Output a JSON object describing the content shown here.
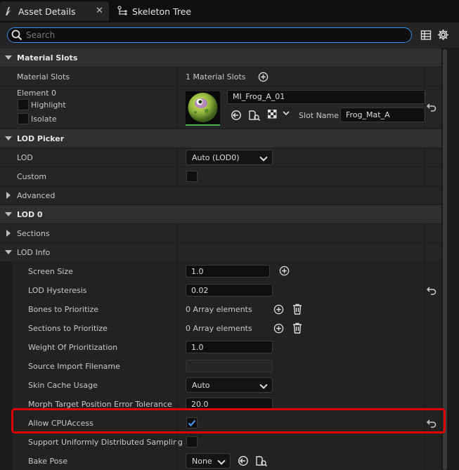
{
  "tabs": [
    {
      "label": "Asset Details",
      "active": true
    },
    {
      "label": "Skeleton Tree",
      "active": false
    }
  ],
  "search": {
    "placeholder": "Search",
    "value": ""
  },
  "sections": {
    "material_slots": "Material Slots",
    "lod_picker": "LOD Picker",
    "advanced": "Advanced",
    "lod0": "LOD 0",
    "sections": "Sections",
    "lod_info": "LOD Info"
  },
  "material": {
    "slots_label": "Material Slots",
    "slots_value": "1 Material Slots",
    "element_label": "Element 0",
    "highlight_label": "Highlight",
    "isolate_label": "Isolate",
    "material_name": "MI_Frog_A_01",
    "slot_name_label": "Slot Name",
    "slot_name_value": "Frog_Mat_A"
  },
  "lod_picker": {
    "lod_label": "LOD",
    "lod_value": "Auto (LOD0)",
    "custom_label": "Custom"
  },
  "lod_info": {
    "screen_size_label": "Screen Size",
    "screen_size_value": "1.0",
    "hysteresis_label": "LOD Hysteresis",
    "hysteresis_value": "0.02",
    "bones_label": "Bones to Prioritize",
    "bones_value": "0 Array elements",
    "sections_prio_label": "Sections to Prioritize",
    "sections_prio_value": "0 Array elements",
    "weight_label": "Weight Of Prioritization",
    "weight_value": "1.0",
    "source_label": "Source Import Filename",
    "source_value": "",
    "skin_label": "Skin Cache Usage",
    "skin_value": "Auto",
    "morph_label": "Morph Target Position Error Tolerance",
    "morph_value": "20.0",
    "cpu_label": "Allow CPUAccess",
    "cpu_checked": true,
    "uniform_label": "Support Uniformly Distributed Sampling",
    "bake_label": "Bake Pose",
    "bake_value": "None"
  },
  "colors": {
    "accent": "#3a8ee6",
    "highlight_box": "#e00000",
    "check": "#4a9df8"
  }
}
